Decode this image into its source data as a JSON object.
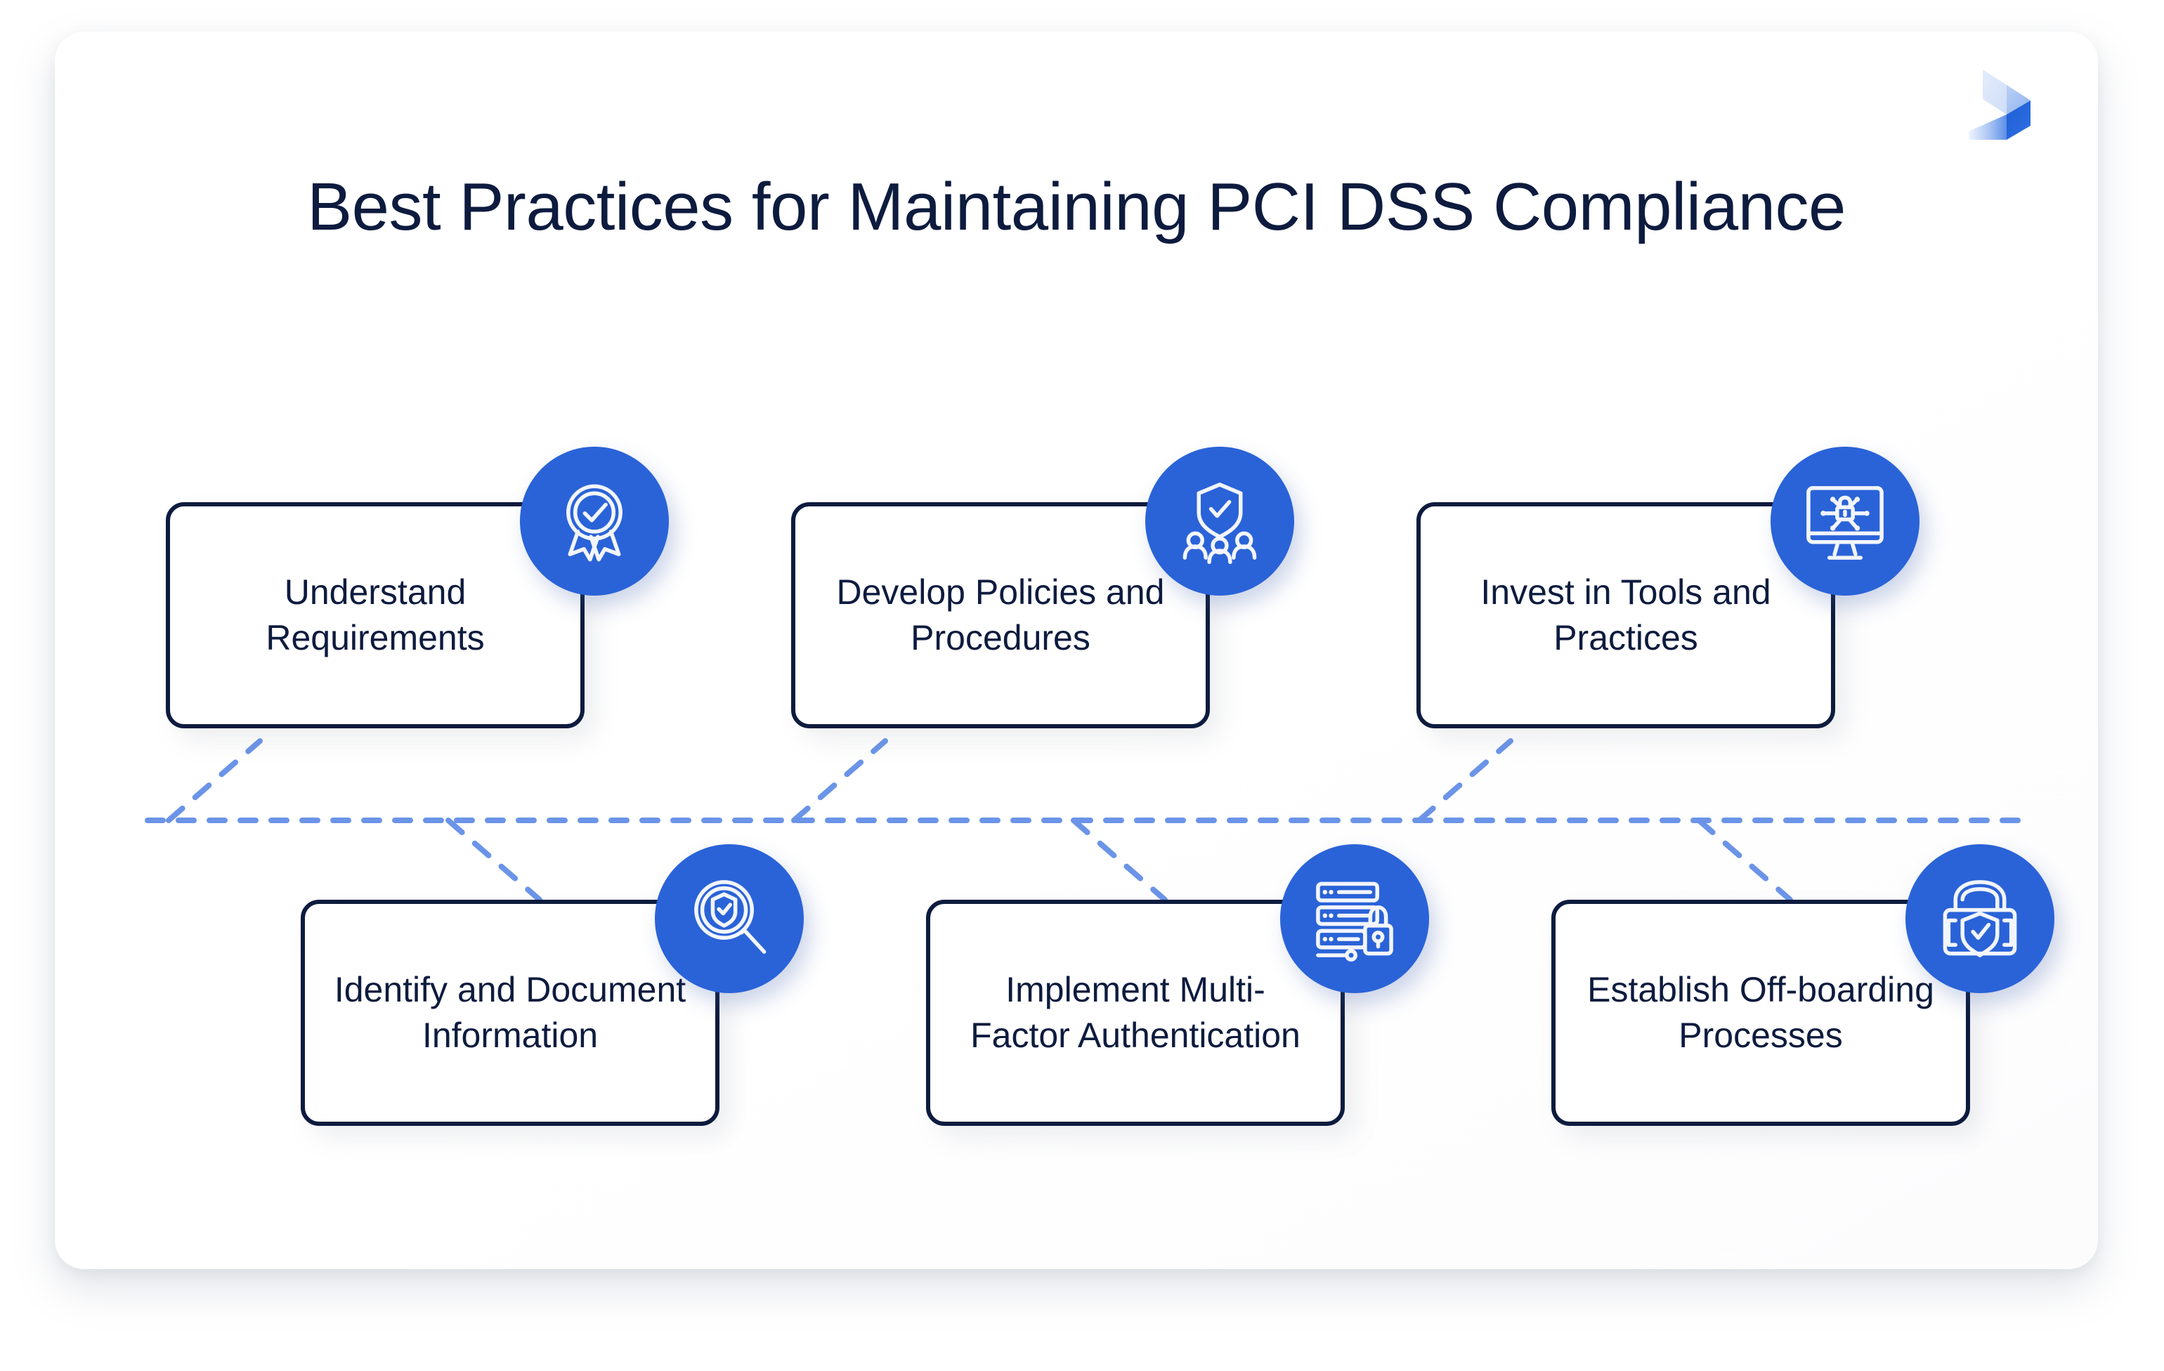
{
  "brand": {
    "logo_icon": "bold-b-isometric-logo",
    "accent_blue": "#2A63D8",
    "accent_light_blue": "#6B94E8",
    "ink_navy": "#0D1B3E",
    "surface_white": "#FFFFFF"
  },
  "header": {
    "title": "Best Practices for Maintaining PCI DSS Compliance"
  },
  "diagram": {
    "type": "fishbone",
    "spine_label": "",
    "cards": [
      {
        "id": "understand-requirements",
        "label": "Understand Requirements",
        "icon": "award-badge-check-icon",
        "row": "top",
        "position": 1
      },
      {
        "id": "develop-policies-and-procedures",
        "label": "Develop Policies and Procedures",
        "icon": "shield-check-people-icon",
        "row": "top",
        "position": 2
      },
      {
        "id": "invest-in-tools-and-practices",
        "label": "Invest in Tools and Practices",
        "icon": "monitor-lock-network-icon",
        "row": "top",
        "position": 3
      },
      {
        "id": "identify-and-document-information",
        "label": "Identify and Document Information",
        "icon": "magnifier-shield-check-icon",
        "row": "bottom",
        "position": 1
      },
      {
        "id": "implement-multi-factor-authentication",
        "label": "Implement Multi-Factor Authentication",
        "icon": "server-rack-lock-icon",
        "row": "bottom",
        "position": 2
      },
      {
        "id": "establish-off-boarding-processes",
        "label": "Establish Off-boarding Processes",
        "icon": "padlock-shield-check-icon",
        "row": "bottom",
        "position": 3
      }
    ]
  }
}
